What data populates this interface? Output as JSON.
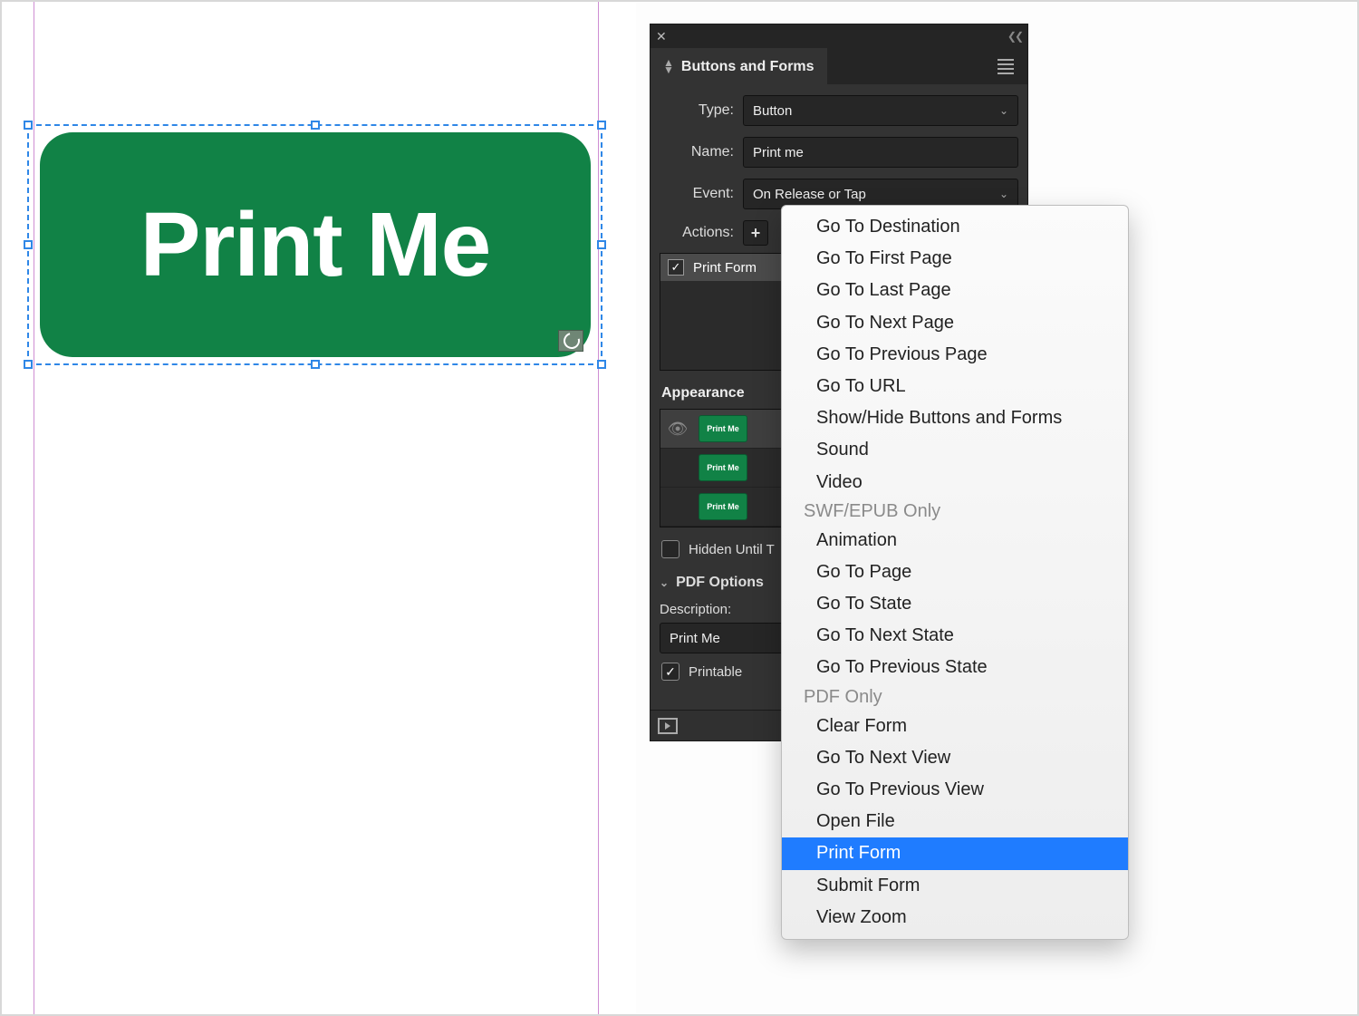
{
  "canvas": {
    "button_text": "Print Me"
  },
  "panel": {
    "title": "Buttons and Forms",
    "fields": {
      "type_label": "Type:",
      "type_value": "Button",
      "name_label": "Name:",
      "name_value": "Print me",
      "event_label": "Event:",
      "event_value": "On Release or Tap",
      "actions_label": "Actions:"
    },
    "actions_list": [
      "Print Form"
    ],
    "appearance_label": "Appearance",
    "appearance_states": [
      "Print Me",
      "Print Me",
      "Print Me"
    ],
    "hidden_label": "Hidden Until T",
    "hidden_checked": false,
    "pdf_options_label": "PDF Options",
    "description_label": "Description:",
    "description_value": "Print Me",
    "printable_label": "Printable",
    "printable_checked": true
  },
  "menu": {
    "group1": [
      "Go To Destination",
      "Go To First Page",
      "Go To Last Page",
      "Go To Next Page",
      "Go To Previous Page",
      "Go To URL",
      "Show/Hide Buttons and Forms",
      "Sound",
      "Video"
    ],
    "group2_header": "SWF/EPUB Only",
    "group2": [
      "Animation",
      "Go To Page",
      "Go To State",
      "Go To Next State",
      "Go To Previous State"
    ],
    "group3_header": "PDF Only",
    "group3": [
      "Clear Form",
      "Go To Next View",
      "Go To Previous View",
      "Open File",
      "Print Form",
      "Submit Form",
      "View Zoom"
    ],
    "selected": "Print Form"
  }
}
